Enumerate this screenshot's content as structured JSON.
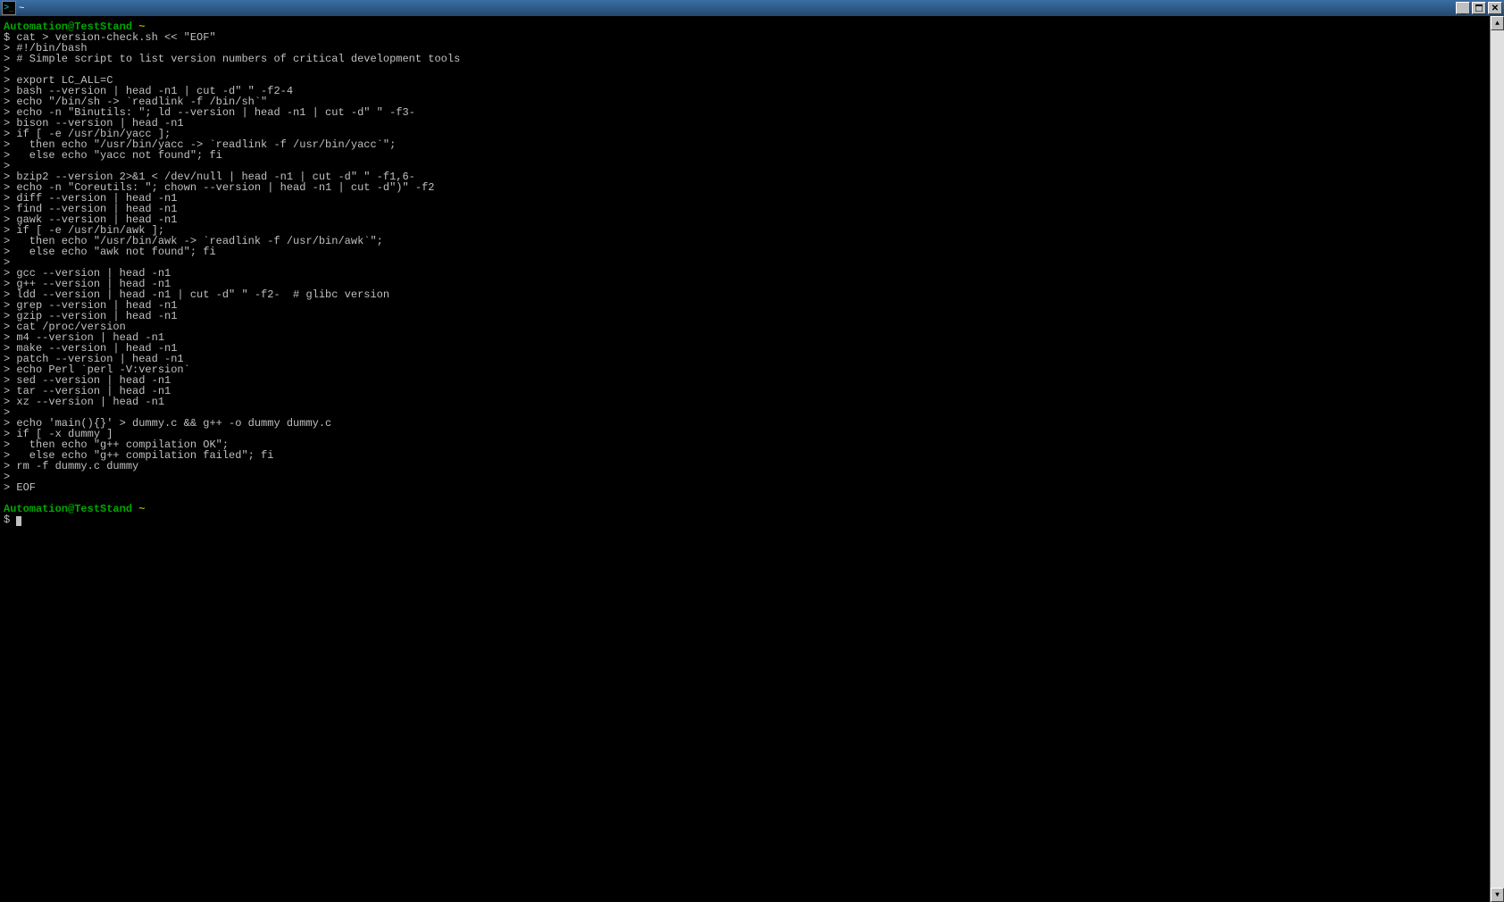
{
  "window": {
    "title": "~",
    "icon_glyph": ">_"
  },
  "buttons": {
    "minimize_glyph": "_",
    "close_glyph": "✕"
  },
  "prompt": {
    "user_host": "Automation@TestStand",
    "cwd": "~",
    "ps1": "$",
    "ps2": ">"
  },
  "command1": "cat > version-check.sh << \"EOF\"",
  "heredoc": [
    "#!/bin/bash",
    "# Simple script to list version numbers of critical development tools",
    "",
    "export LC_ALL=C",
    "bash --version | head -n1 | cut -d\" \" -f2-4",
    "echo \"/bin/sh -> `readlink -f /bin/sh`\"",
    "echo -n \"Binutils: \"; ld --version | head -n1 | cut -d\" \" -f3-",
    "bison --version | head -n1",
    "if [ -e /usr/bin/yacc ];",
    "  then echo \"/usr/bin/yacc -> `readlink -f /usr/bin/yacc`\";",
    "  else echo \"yacc not found\"; fi",
    "",
    "bzip2 --version 2>&1 < /dev/null | head -n1 | cut -d\" \" -f1,6-",
    "echo -n \"Coreutils: \"; chown --version | head -n1 | cut -d\")\" -f2",
    "diff --version | head -n1",
    "find --version | head -n1",
    "gawk --version | head -n1",
    "if [ -e /usr/bin/awk ];",
    "  then echo \"/usr/bin/awk -> `readlink -f /usr/bin/awk`\";",
    "  else echo \"awk not found\"; fi",
    "",
    "gcc --version | head -n1",
    "g++ --version | head -n1",
    "ldd --version | head -n1 | cut -d\" \" -f2-  # glibc version",
    "grep --version | head -n1",
    "gzip --version | head -n1",
    "cat /proc/version",
    "m4 --version | head -n1",
    "make --version | head -n1",
    "patch --version | head -n1",
    "echo Perl `perl -V:version`",
    "sed --version | head -n1",
    "tar --version | head -n1",
    "xz --version | head -n1",
    "",
    "echo 'main(){}' > dummy.c && g++ -o dummy dummy.c",
    "if [ -x dummy ]",
    "  then echo \"g++ compilation OK\";",
    "  else echo \"g++ compilation failed\"; fi",
    "rm -f dummy.c dummy",
    "",
    "EOF"
  ]
}
